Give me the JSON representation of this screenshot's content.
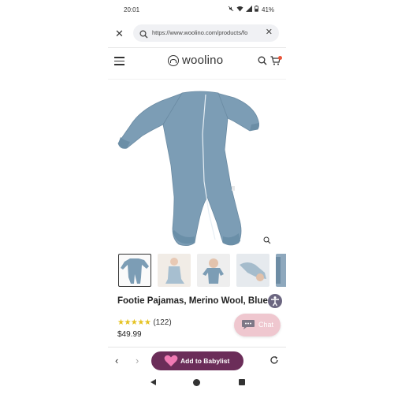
{
  "status_bar": {
    "time": "20:01",
    "icons": [
      "mute-icon",
      "wifi-icon",
      "signal-icon",
      "battery-icon"
    ],
    "battery_pct": "41%"
  },
  "browser": {
    "url": "https://www.woolino.com/products/fo",
    "icons": [
      "close-icon",
      "search-icon",
      "clear-icon"
    ]
  },
  "site": {
    "logo_text": "woolino",
    "icons": [
      "menu-icon",
      "search-icon",
      "cart-icon"
    ]
  },
  "product": {
    "title": "Footie Pajamas, Merino Wool, Blue",
    "rating_stars": 5,
    "stars_text": "★★★★★",
    "review_count": "(122)",
    "price": "$49.99",
    "thumbnails": [
      "flat-lay",
      "baby-sitting",
      "baby-lying",
      "baby-side",
      "detail"
    ],
    "selected_thumbnail": 0
  },
  "chat": {
    "label": "Chat"
  },
  "bottom_bar": {
    "babylist_label": "Add to Babylist",
    "icons": [
      "back-icon",
      "forward-icon",
      "heart-icon",
      "reload-icon"
    ]
  },
  "colors": {
    "garment_blue": "#7c9db5",
    "babylist_purple": "#6b2d59",
    "chat_pink": "#efc7cf",
    "star_yellow": "#e5c221",
    "a11y_gray": "#6b6680"
  }
}
